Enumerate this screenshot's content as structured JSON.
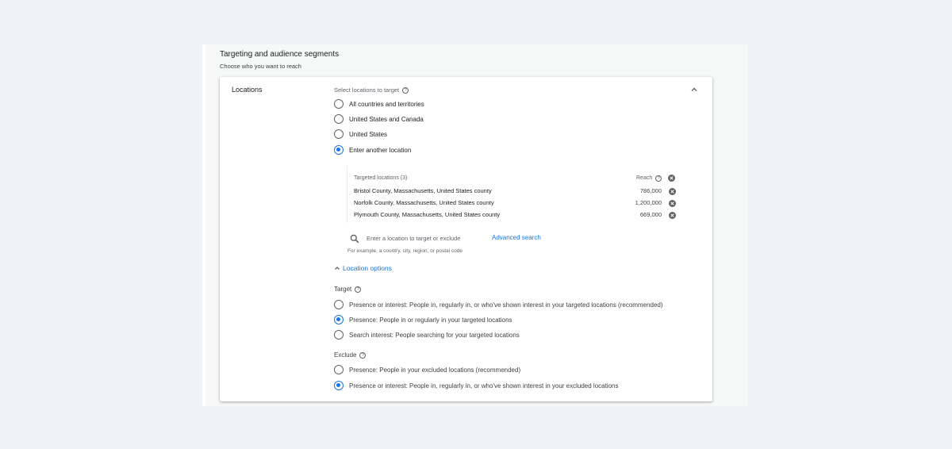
{
  "section": {
    "title": "Targeting and audience segments",
    "subtitle": "Choose who you want to reach"
  },
  "card": {
    "label": "Locations",
    "select_label": "Select locations to target",
    "location_choices": [
      {
        "label": "All countries and territories",
        "selected": false
      },
      {
        "label": "United States and Canada",
        "selected": false
      },
      {
        "label": "United States",
        "selected": false
      },
      {
        "label": "Enter another location",
        "selected": true
      }
    ],
    "targeted": {
      "header": "Targeted locations (3)",
      "reach_label": "Reach",
      "rows": [
        {
          "name": "Bristol County, Massachusetts, United States county",
          "reach": "786,000"
        },
        {
          "name": "Norfolk County, Massachusetts, United States county",
          "reach": "1,200,000"
        },
        {
          "name": "Plymouth County, Massachusetts, United States county",
          "reach": "669,000"
        }
      ]
    },
    "search": {
      "placeholder": "Enter a location to target or exclude",
      "advanced": "Advanced search",
      "example": "For example, a country, city, region, or postal code"
    },
    "location_options": {
      "toggle_label": "Location options",
      "target_label": "Target",
      "target_choices": [
        {
          "label": "Presence or interest: People in, regularly in, or who've shown interest in your targeted locations (recommended)",
          "selected": false
        },
        {
          "label": "Presence: People in or regularly in your targeted locations",
          "selected": true
        },
        {
          "label": "Search interest: People searching for your targeted locations",
          "selected": false
        }
      ],
      "exclude_label": "Exclude",
      "exclude_choices": [
        {
          "label": "Presence: People in your excluded locations (recommended)",
          "selected": false
        },
        {
          "label": "Presence or interest: People in, regularly in, or who've shown interest in your excluded locations",
          "selected": true
        }
      ]
    }
  },
  "icons": {
    "help": "help-circle-icon",
    "remove": "remove-circle-icon",
    "search": "search-icon",
    "collapse": "chevron-up-icon"
  },
  "colors": {
    "accent": "#1a73e8",
    "text": "#202124",
    "muted": "#5f6368"
  }
}
